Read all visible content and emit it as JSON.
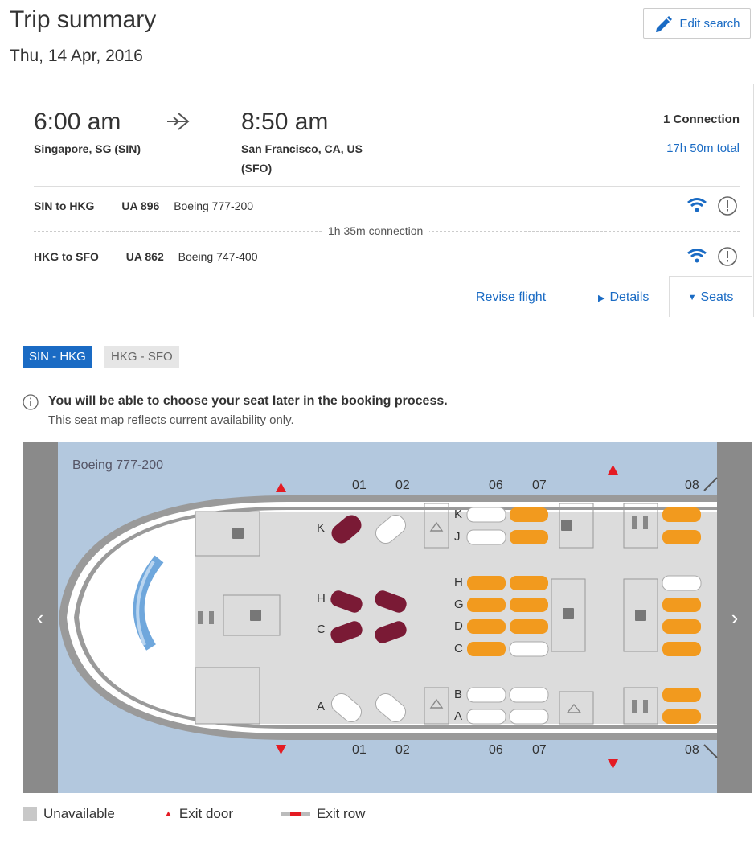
{
  "header": {
    "title": "Trip summary",
    "date": "Thu, 14 Apr, 2016",
    "edit_label": "Edit search"
  },
  "flight": {
    "depart_time": "6:00 am",
    "depart_city": "Singapore, SG (SIN)",
    "arrive_time": "8:50 am",
    "arrive_city_line1": "San Francisco, CA, US",
    "arrive_city_line2": "(SFO)",
    "connections": "1 Connection",
    "total": "17h 50m total",
    "segments": [
      {
        "route": "SIN to HKG",
        "flight": "UA 896",
        "aircraft": "Boeing 777-200"
      },
      {
        "route": "HKG to SFO",
        "flight": "UA 862",
        "aircraft": "Boeing 747-400"
      }
    ],
    "connection_text": "1h 35m connection"
  },
  "actions": {
    "revise": "Revise flight",
    "details": "Details",
    "seats": "Seats"
  },
  "seat_tabs": [
    "SIN - HKG",
    "HKG - SFO"
  ],
  "info": {
    "bold": "You will be able to choose your seat later in the booking process.",
    "sub": "This seat map reflects current availability only."
  },
  "seatmap": {
    "aircraft": "Boeing 777-200",
    "row_labels": [
      "01",
      "02",
      "06",
      "07",
      "08"
    ],
    "letters_first": [
      "K",
      "H",
      "C",
      "A"
    ],
    "letters_economy": [
      "K",
      "J",
      "H",
      "G",
      "D",
      "C",
      "B",
      "A"
    ]
  },
  "legend": {
    "unavailable": "Unavailable",
    "exit_door": "Exit door",
    "exit_row": "Exit row"
  },
  "colors": {
    "link": "#1a6bc4",
    "tab_active": "#1a6bc4",
    "map_bg": "#b3c8de",
    "seat_orange": "#f29a1e",
    "seat_maroon": "#7a1a35",
    "exit_red": "#e41b23"
  }
}
